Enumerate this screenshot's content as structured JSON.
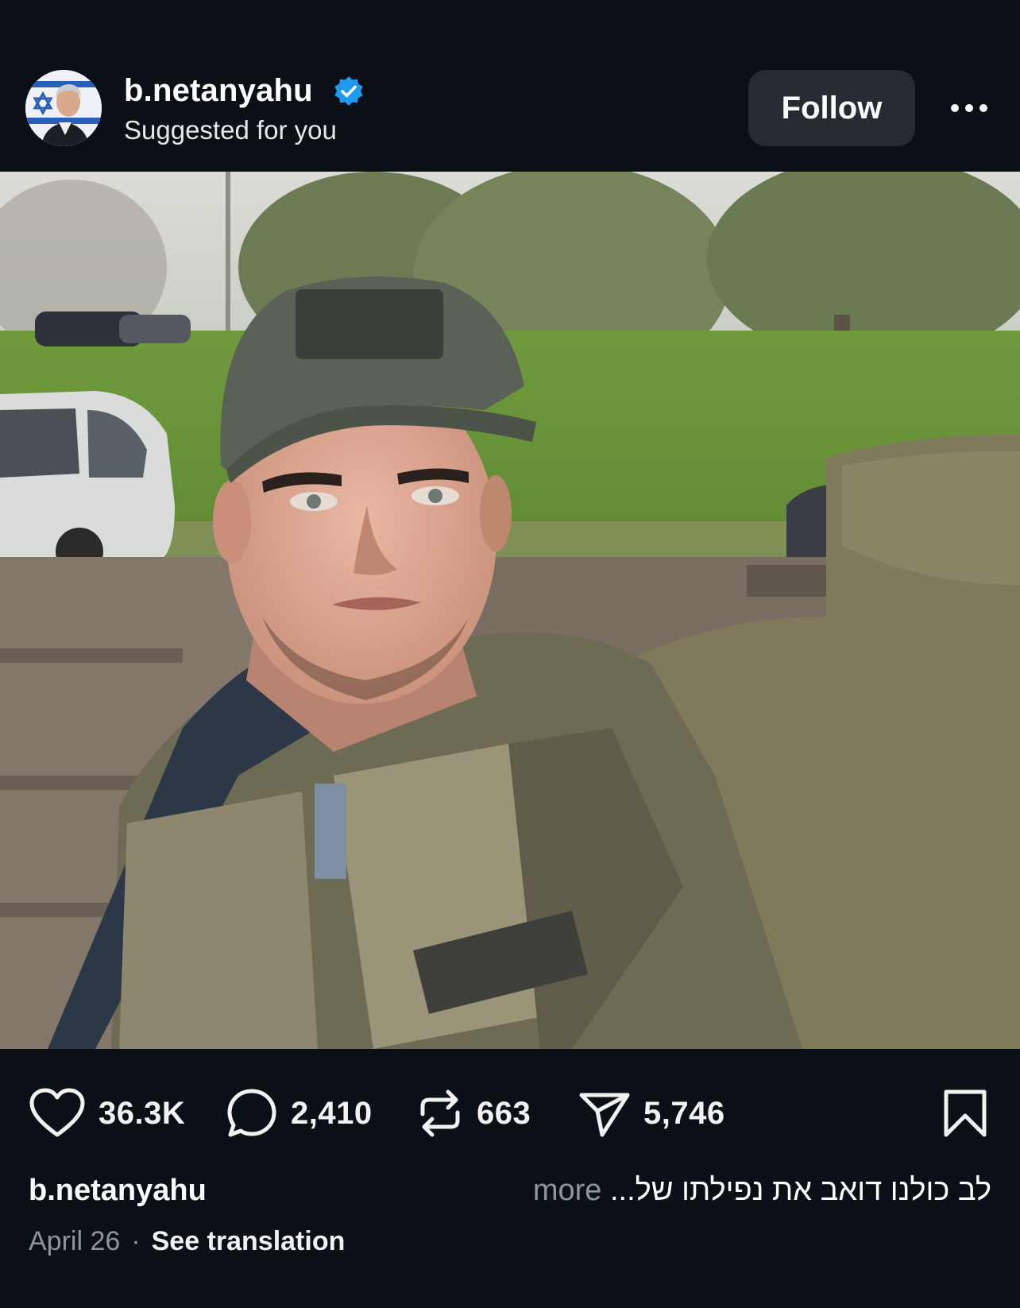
{
  "post": {
    "author": {
      "username": "b.netanyahu",
      "verified": true,
      "subtitle": "Suggested for you"
    },
    "follow_label": "Follow",
    "more_icon": "ellipsis-icon",
    "image_alt": "selfie of a soldier in a cap and tactical vest seated in a vehicle, trees and parked cars behind",
    "stats": {
      "likes": "36.3K",
      "comments": "2,410",
      "reposts": "663",
      "shares": "5,746"
    },
    "caption": {
      "username": "b.netanyahu",
      "text": "לב כולנו דואב את נפילתו של...",
      "more_label": "more"
    },
    "date": "April 26",
    "separator": "·",
    "translation_label": "See translation"
  },
  "colors": {
    "background": "#0b1017",
    "follow_button": "#262a31",
    "verified_badge": "#1d9bf0",
    "muted_text": "#8e959e"
  }
}
